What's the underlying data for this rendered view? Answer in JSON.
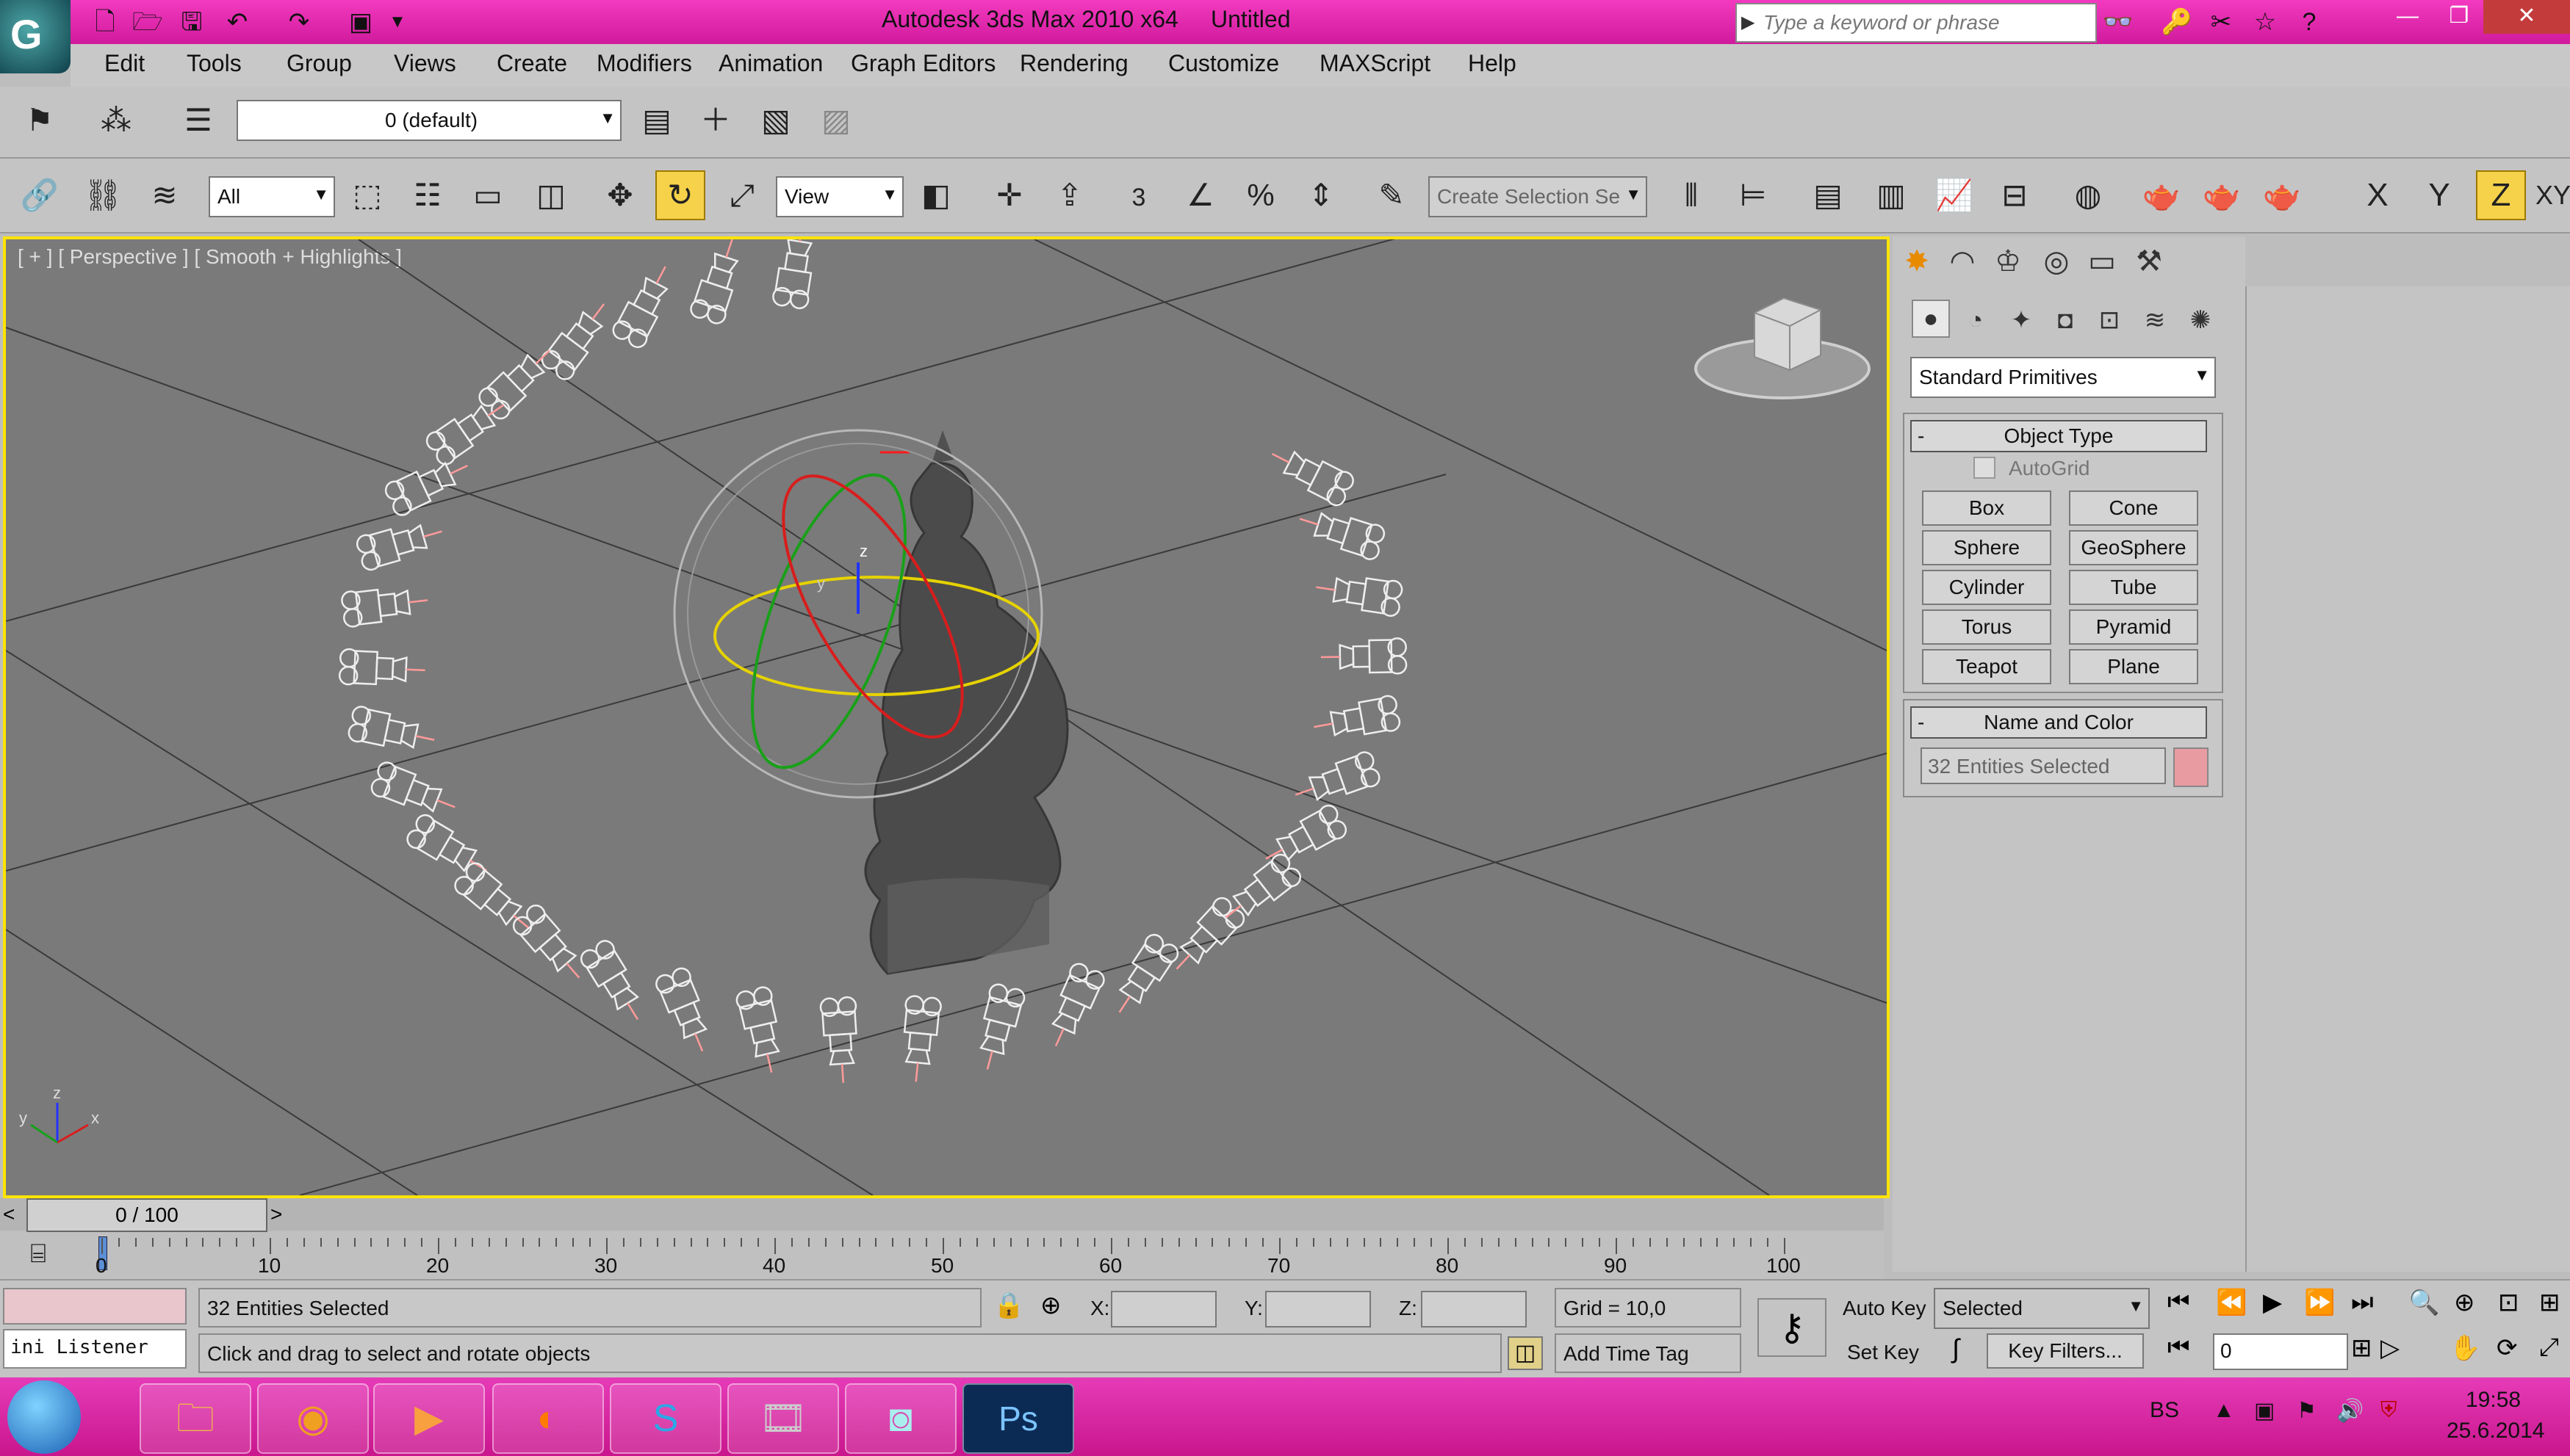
{
  "titlebar": {
    "app": "Autodesk 3ds Max  2010 x64",
    "doc": "Untitled",
    "search_placeholder": "Type a keyword or phrase"
  },
  "menubar": {
    "items": [
      "Edit",
      "Tools",
      "Group",
      "Views",
      "Create",
      "Modifiers",
      "Animation",
      "Graph Editors",
      "Rendering",
      "Customize",
      "MAXScript",
      "Help"
    ]
  },
  "toolbar1": {
    "layer": "0 (default)"
  },
  "toolbar2": {
    "filter": "All",
    "coord": "View",
    "snap_num": "3",
    "selection_set": "Create Selection Se",
    "axes": [
      "X",
      "Y",
      "Z",
      "XY"
    ]
  },
  "viewport": {
    "label": "[ + ] [ Perspective ] [ Smooth + Highlights ]",
    "gizmo_z": "z",
    "gizmo_y": "y",
    "axis_x": "x",
    "axis_y": "y",
    "axis_z": "z"
  },
  "command_panel": {
    "category": "Standard Primitives",
    "object_type": {
      "title": "Object Type",
      "autogrid": "AutoGrid",
      "buttons": [
        "Box",
        "Cone",
        "Sphere",
        "GeoSphere",
        "Cylinder",
        "Tube",
        "Torus",
        "Pyramid",
        "Teapot",
        "Plane"
      ]
    },
    "name_color": {
      "title": "Name and Color",
      "name": "32 Entities Selected",
      "color": "#e89ba0"
    }
  },
  "timeline": {
    "frame": "0 / 100",
    "ticks": [
      "0",
      "10",
      "20",
      "30",
      "40",
      "50",
      "60",
      "70",
      "80",
      "90",
      "100"
    ]
  },
  "status": {
    "selected": "32 Entities Selected",
    "prompt": "Click and drag to select and rotate objects",
    "listener": "ini Listener",
    "x_label": "X:",
    "y_label": "Y:",
    "z_label": "Z:",
    "grid": "Grid = 10,0",
    "add_time_tag": "Add Time Tag",
    "auto_key": "Auto Key",
    "set_key": "Set Key",
    "key_mode": "Selected",
    "key_filters": "Key Filters...",
    "current_frame": "0"
  },
  "taskbar": {
    "lang": "BS",
    "time": "19:58",
    "date": "25.6.2014",
    "ps_label": "Ps"
  }
}
